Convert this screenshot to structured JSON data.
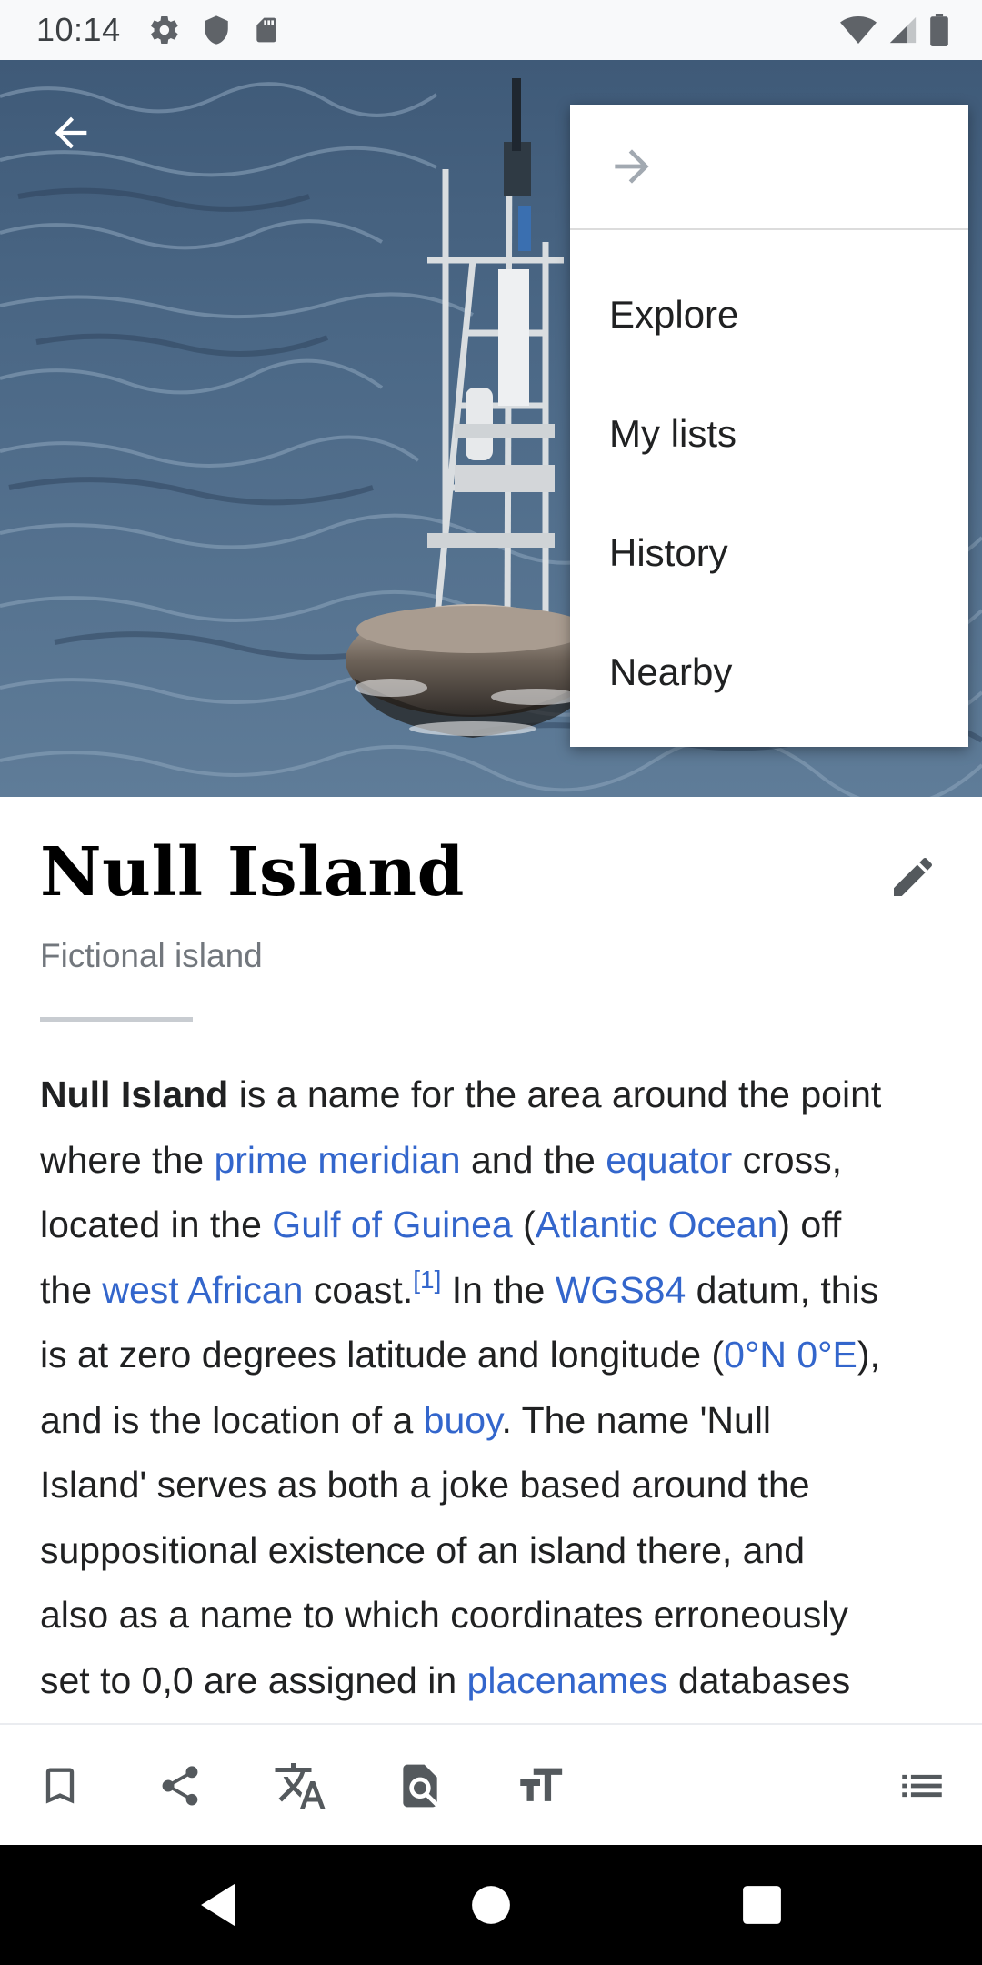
{
  "status_bar": {
    "time": "10:14",
    "left_icons": [
      "gear-icon",
      "shield-icon",
      "sd-card-icon"
    ],
    "right_icons": [
      "wifi-icon",
      "signal-icon",
      "battery-icon"
    ]
  },
  "hero_image": {
    "subject": "buoy-at-sea",
    "back_icon": "arrow-back-icon"
  },
  "overflow_menu": {
    "forward_icon": "arrow-forward-icon",
    "items": [
      {
        "label": "Explore"
      },
      {
        "label": "My lists"
      },
      {
        "label": "History"
      },
      {
        "label": "Nearby"
      }
    ]
  },
  "article": {
    "title": "Null Island",
    "description": "Fictional island",
    "edit_icon": "pencil-icon",
    "lines": [
      [
        {
          "t": "Null Island",
          "s": "bold"
        },
        {
          "t": " is a name for the area around the point"
        }
      ],
      [
        {
          "t": "where the "
        },
        {
          "t": "prime meridian",
          "s": "link"
        },
        {
          "t": " and the "
        },
        {
          "t": "equator",
          "s": "link"
        },
        {
          "t": " cross,"
        }
      ],
      [
        {
          "t": "located in the "
        },
        {
          "t": "Gulf of Guinea",
          "s": "link"
        },
        {
          "t": " ("
        },
        {
          "t": "Atlantic Ocean",
          "s": "link"
        },
        {
          "t": ") off"
        }
      ],
      [
        {
          "t": "the "
        },
        {
          "t": "west African",
          "s": "link"
        },
        {
          "t": " coast."
        },
        {
          "t": "[1]",
          "s": "sup"
        },
        {
          "t": " In the "
        },
        {
          "t": "WGS84",
          "s": "link"
        },
        {
          "t": " datum, this"
        }
      ],
      [
        {
          "t": "is at zero degrees latitude and longitude ("
        },
        {
          "t": "0°N 0°E",
          "s": "link"
        },
        {
          "t": "),"
        }
      ],
      [
        {
          "t": "and is the location of a "
        },
        {
          "t": "buoy",
          "s": "link"
        },
        {
          "t": ". The name 'Null"
        }
      ],
      [
        {
          "t": "Island' serves as both a joke based around the"
        }
      ],
      [
        {
          "t": "suppositional existence of an island there, and"
        }
      ],
      [
        {
          "t": "also as a name to which coordinates erroneously"
        }
      ],
      [
        {
          "t": "set to 0,0 are assigned in "
        },
        {
          "t": "placenames",
          "s": "link"
        },
        {
          "t": " databases"
        }
      ]
    ]
  },
  "toolbar": {
    "buttons": [
      "bookmark-icon",
      "share-icon",
      "translate-icon",
      "find-in-page-icon",
      "text-size-icon",
      "contents-icon"
    ]
  },
  "navbar": {
    "buttons": [
      "back-triangle-icon",
      "home-circle-icon",
      "recents-square-icon"
    ]
  },
  "colors": {
    "link": "#3366cc",
    "text": "#202122",
    "secondary": "#72777d",
    "icon": "#54595d"
  }
}
